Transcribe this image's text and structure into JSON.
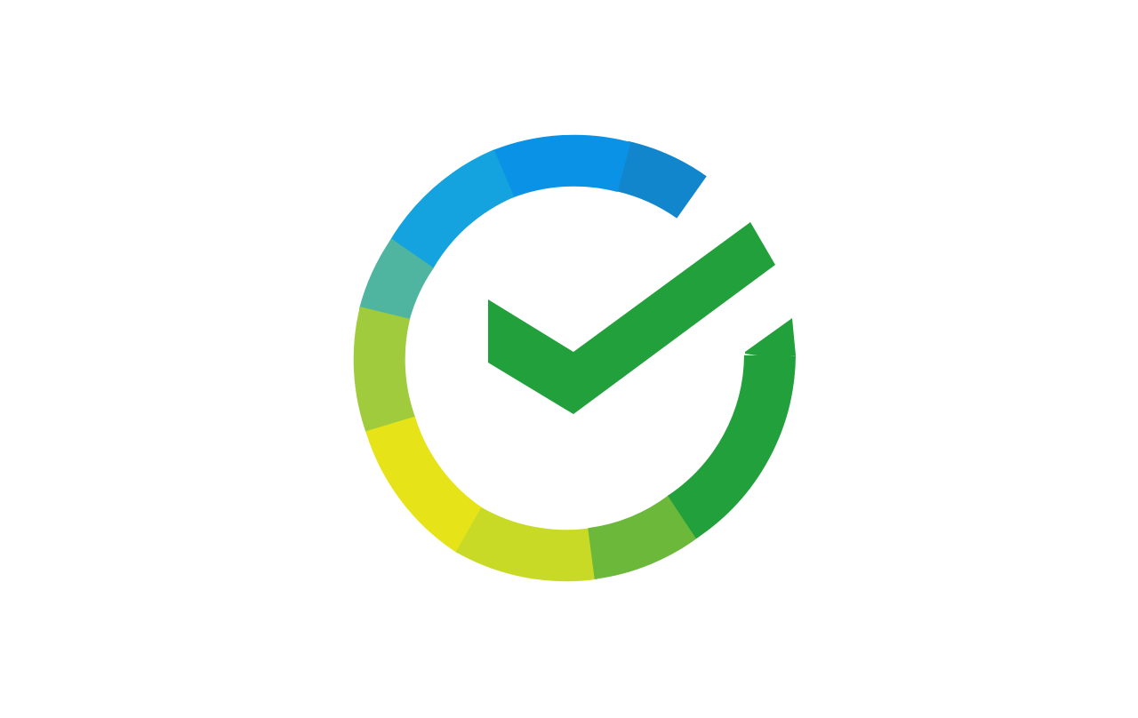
{
  "logo": {
    "icon": "checkmark-ring-icon",
    "colors": {
      "blue": "#0f8fe6",
      "deep_blue": "#1285cf",
      "teal": "#3ab3c6",
      "lime": "#a2cb3b",
      "yellow": "#eae515",
      "green": "#22a03b",
      "background": "#ffffff"
    }
  }
}
